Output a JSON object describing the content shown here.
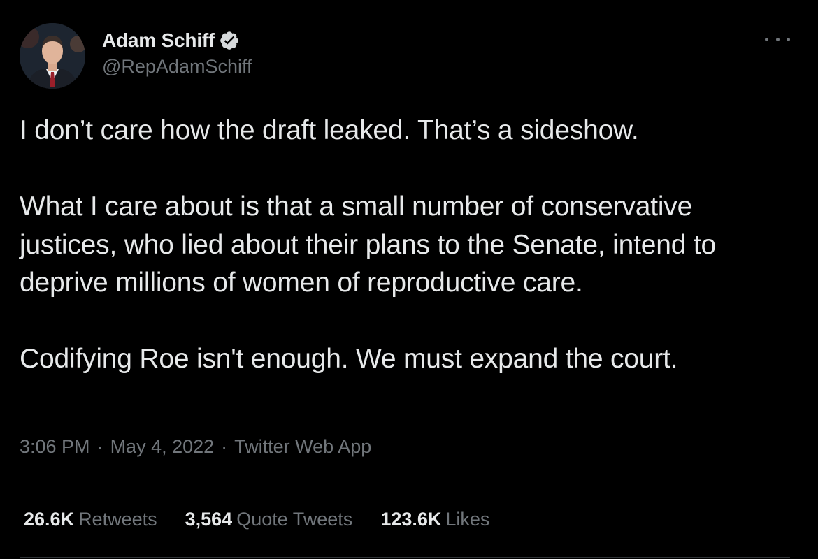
{
  "author": {
    "display_name": "Adam Schiff",
    "handle": "@RepAdamSchiff",
    "verified": true,
    "avatar_icon": "user-avatar-photo",
    "verified_icon": "verified-badge-icon"
  },
  "tweet": {
    "paragraphs": [
      "I don’t care how the draft leaked. That’s a sideshow.",
      "What I care about is that a small number of conservative justices, who lied about their plans to the Senate, intend to deprive millions of women of reproductive care.",
      "Codifying Roe isn't enough. We must expand the court."
    ]
  },
  "meta": {
    "time": "3:06 PM",
    "separator": "·",
    "date": "May 4, 2022",
    "source": "Twitter Web App"
  },
  "stats": [
    {
      "value": "26.6K",
      "label": "Retweets"
    },
    {
      "value": "3,564",
      "label": "Quote Tweets"
    },
    {
      "value": "123.6K",
      "label": "Likes"
    }
  ],
  "menu": {
    "more_icon": "more-horizontal-icon"
  },
  "colors": {
    "background": "#000000",
    "text_primary": "#e7e9ea",
    "text_secondary": "#71767b",
    "divider": "#2f3336"
  }
}
